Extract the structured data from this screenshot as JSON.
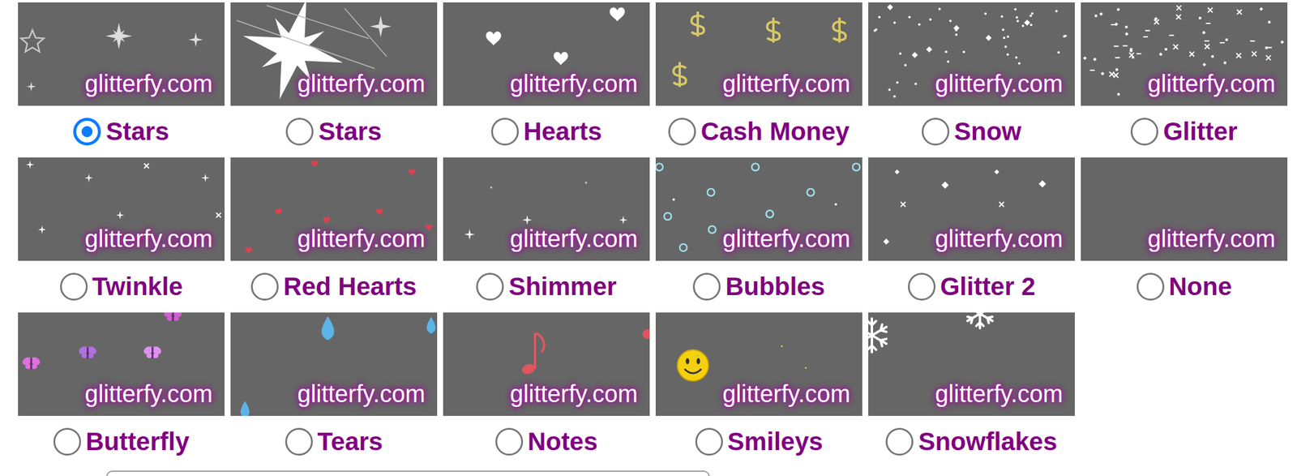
{
  "effects": [
    {
      "label": "Stars",
      "preview": "glitterfy.com",
      "kind": "sparkle",
      "selected": true
    },
    {
      "label": "Stars",
      "preview": "glitterfy.com",
      "kind": "burst",
      "selected": false
    },
    {
      "label": "Hearts",
      "preview": "glitterfy.com",
      "kind": "hearts",
      "selected": false
    },
    {
      "label": "Cash Money",
      "preview": "glitterfy.com",
      "kind": "dollars",
      "selected": false
    },
    {
      "label": "Snow",
      "preview": "glitterfy.com",
      "kind": "snow",
      "selected": false
    },
    {
      "label": "Glitter",
      "preview": "glitterfy.com",
      "kind": "glitter",
      "selected": false
    },
    {
      "label": "Twinkle",
      "preview": "glitterfy.com",
      "kind": "twinkle",
      "selected": false
    },
    {
      "label": "Red Hearts",
      "preview": "glitterfy.com",
      "kind": "redhearts",
      "selected": false
    },
    {
      "label": "Shimmer",
      "preview": "glitterfy.com",
      "kind": "shimmer",
      "selected": false
    },
    {
      "label": "Bubbles",
      "preview": "glitterfy.com",
      "kind": "bubbles",
      "selected": false
    },
    {
      "label": "Glitter 2",
      "preview": "glitterfy.com",
      "kind": "glitter2",
      "selected": false
    },
    {
      "label": "None",
      "preview": "glitterfy.com",
      "kind": "none",
      "selected": false
    },
    {
      "label": "Butterfly",
      "preview": "glitterfy.com",
      "kind": "butterfly",
      "selected": false
    },
    {
      "label": "Tears",
      "preview": "glitterfy.com",
      "kind": "tears",
      "selected": false
    },
    {
      "label": "Notes",
      "preview": "glitterfy.com",
      "kind": "notes",
      "selected": false
    },
    {
      "label": "Smileys",
      "preview": "glitterfy.com",
      "kind": "smiley",
      "selected": false
    },
    {
      "label": "Snowflakes",
      "preview": "glitterfy.com",
      "kind": "snowflakes",
      "selected": false
    }
  ]
}
